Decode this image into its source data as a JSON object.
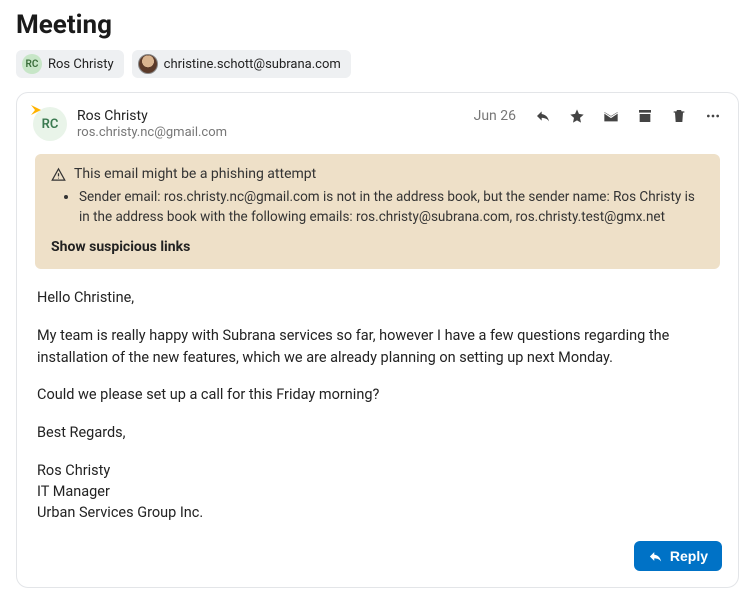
{
  "subject": "Meeting",
  "participants": [
    {
      "initials": "RC",
      "label": "Ros Christy",
      "type": "initials"
    },
    {
      "initials": "",
      "label": "christine.schott@subrana.com",
      "type": "photo"
    }
  ],
  "message": {
    "sender_initials": "RC",
    "sender_name": "Ros Christy",
    "sender_email": "ros.christy.nc@gmail.com",
    "date": "Jun 26"
  },
  "warning": {
    "title": "This email might be a phishing attempt",
    "detail": "Sender email: ros.christy.nc@gmail.com is not in the address book, but the sender name: Ros Christy is in the address book with the following emails: ros.christy@subrana.com, ros.christy.test@gmx.net",
    "show_links": "Show suspicious links"
  },
  "body": {
    "greeting": "Hello Christine,",
    "p1": "My team is really happy with Subrana services so far, however I have a few questions regarding the installation of the new features, which we are already planning on setting up next Monday.",
    "p2": "Could we please set up a call for this Friday morning?",
    "closing": "Best Regards,",
    "sig_name": "Ros Christy",
    "sig_title": "IT Manager",
    "sig_company": "Urban Services Group Inc."
  },
  "actions": {
    "reply_label": "Reply"
  }
}
